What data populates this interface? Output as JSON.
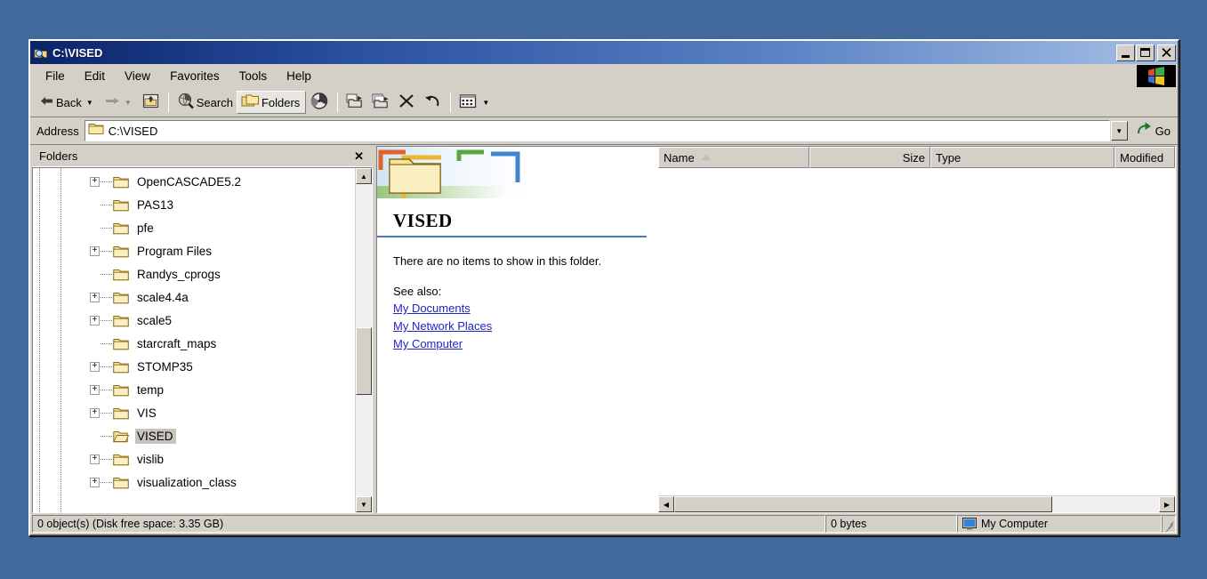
{
  "window": {
    "title": "C:\\VISED",
    "title_icon": "folder-search-icon",
    "minimize_glyph": "_",
    "maximize_glyph": "□",
    "close_glyph": "✕"
  },
  "menubar": {
    "items": [
      {
        "label": "File",
        "name": "menu-file"
      },
      {
        "label": "Edit",
        "name": "menu-edit"
      },
      {
        "label": "View",
        "name": "menu-view"
      },
      {
        "label": "Favorites",
        "name": "menu-favorites"
      },
      {
        "label": "Tools",
        "name": "menu-tools"
      },
      {
        "label": "Help",
        "name": "menu-help"
      }
    ],
    "brand_icon": "windows-logo-icon"
  },
  "toolbar": {
    "back_label": "Back",
    "back_icon": "back-arrow-icon",
    "back_dropdown_icon": "chevron-down-icon",
    "forward_icon": "forward-arrow-icon",
    "forward_dropdown_icon": "chevron-down-icon",
    "up_icon": "up-folder-icon",
    "search_label": "Search",
    "search_icon": "search-globe-icon",
    "folders_label": "Folders",
    "folders_icon": "folders-icon",
    "history_icon": "history-clock-icon",
    "moveto_icon": "move-to-folder-icon",
    "copyto_icon": "copy-to-folder-icon",
    "delete_icon": "delete-x-icon",
    "undo_icon": "undo-arrow-icon",
    "views_icon": "views-icon",
    "views_dropdown_icon": "chevron-down-icon"
  },
  "address": {
    "label": "Address",
    "value": "C:\\VISED",
    "folder_icon": "folder-icon",
    "dropdown_icon": "chevron-down-icon",
    "go_label": "Go",
    "go_icon": "go-arrow-icon"
  },
  "folders_pane": {
    "header_title": "Folders",
    "close_icon": "close-icon",
    "scroll_up_icon": "scroll-up-arrow",
    "scroll_down_icon": "scroll-down-arrow",
    "tree": [
      {
        "label": "OpenCASCADE5.2",
        "expandable": true,
        "expander": "+",
        "selected": false
      },
      {
        "label": "PAS13",
        "expandable": false,
        "expander": "",
        "selected": false
      },
      {
        "label": "pfe",
        "expandable": false,
        "expander": "",
        "selected": false
      },
      {
        "label": "Program Files",
        "expandable": true,
        "expander": "+",
        "selected": false
      },
      {
        "label": "Randys_cprogs",
        "expandable": false,
        "expander": "",
        "selected": false
      },
      {
        "label": "scale4.4a",
        "expandable": true,
        "expander": "+",
        "selected": false
      },
      {
        "label": "scale5",
        "expandable": true,
        "expander": "+",
        "selected": false
      },
      {
        "label": "starcraft_maps",
        "expandable": false,
        "expander": "",
        "selected": false
      },
      {
        "label": "STOMP35",
        "expandable": true,
        "expander": "+",
        "selected": false
      },
      {
        "label": "temp",
        "expandable": true,
        "expander": "+",
        "selected": false
      },
      {
        "label": "VIS",
        "expandable": true,
        "expander": "+",
        "selected": false
      },
      {
        "label": "VISED",
        "expandable": false,
        "expander": "",
        "selected": true
      },
      {
        "label": "vislib",
        "expandable": true,
        "expander": "+",
        "selected": false
      },
      {
        "label": "visualization_class",
        "expandable": true,
        "expander": "+",
        "selected": false
      }
    ]
  },
  "info_pane": {
    "title": "VISED",
    "banner_icon": "folder-banner-icon",
    "empty_message": "There are no items to show in this folder.",
    "see_also_label": "See also:",
    "links": [
      {
        "label": "My Documents",
        "name": "link-my-documents"
      },
      {
        "label": "My Network Places",
        "name": "link-my-network-places"
      },
      {
        "label": "My Computer",
        "name": "link-my-computer"
      }
    ]
  },
  "file_list": {
    "columns": [
      {
        "label": "Name",
        "align": "left",
        "sorted": true,
        "sort_direction": "ascending"
      },
      {
        "label": "Size",
        "align": "right",
        "sorted": false,
        "sort_direction": ""
      },
      {
        "label": "Type",
        "align": "left",
        "sorted": false,
        "sort_direction": ""
      },
      {
        "label": "Modified",
        "align": "left",
        "sorted": false,
        "sort_direction": ""
      }
    ],
    "rows": [],
    "scroll_left_icon": "scroll-left-arrow",
    "scroll_right_icon": "scroll-right-arrow"
  },
  "statusbar": {
    "main": "0 object(s) (Disk free space: 3.35 GB)",
    "bytes": "0 bytes",
    "location": "My Computer",
    "location_icon": "my-computer-icon"
  },
  "colors": {
    "desktop": "#41699b",
    "title_gradient_start": "#0a246a",
    "title_gradient_end": "#a6c0e6",
    "face": "#d4d0c8",
    "link": "#2323c8",
    "info_rule": "#4a79c4",
    "selection": "#c8c4bc"
  }
}
